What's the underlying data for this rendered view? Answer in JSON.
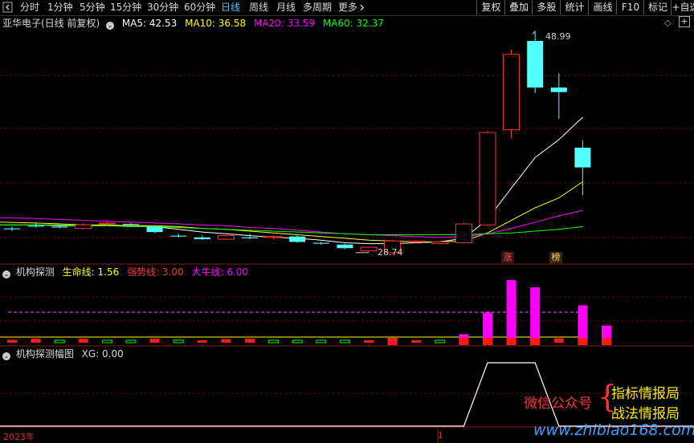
{
  "toolbar": {
    "nav_left_icon": "chevron-left-icon",
    "periods": [
      "分时",
      "1分钟",
      "5分钟",
      "15分钟",
      "30分钟",
      "60分钟",
      "日线",
      "周线",
      "月线",
      "多周期",
      "更多"
    ],
    "active_period": "日线",
    "more_icon": "chevron-right-icon",
    "buttons": [
      "复权",
      "叠加",
      "多股",
      "统计",
      "画线",
      "F10",
      "标记",
      "+自选"
    ]
  },
  "main_chart": {
    "title": "亚华电子(日线 前复权)",
    "ma": [
      {
        "label": "MA5: 42.53",
        "color": "#ffffff"
      },
      {
        "label": "MA10: 36.58",
        "color": "#ffff00"
      },
      {
        "label": "MA20: 33.59",
        "color": "#ff00ff"
      },
      {
        "label": "MA60: 32.37",
        "color": "#00ff00"
      }
    ],
    "high_label": "48.99",
    "low_label": "28.74",
    "badges": [
      "涨",
      "榜"
    ],
    "up_color": "#ff3232",
    "down_color": "#54ffff"
  },
  "indicator1": {
    "title": "机构探测",
    "lines": [
      {
        "label": "生命线: 1.56",
        "color": "#ffff00"
      },
      {
        "label": "强势线: 3.00",
        "color": "#ff3232"
      },
      {
        "label": "大牛线: 6.00",
        "color": "#ff00ff"
      }
    ]
  },
  "indicator2": {
    "title": "机构探测幅图",
    "xg_label": "XG: 0.00"
  },
  "footer": {
    "year_label": "2023年",
    "marker_label": "1"
  },
  "watermark": {
    "wechat_label": "微信公众号",
    "brace": "{",
    "line1": "指标情报局",
    "line2": "战法情报局",
    "url": "www.zhibiao168.com"
  },
  "chart_data": {
    "type": "candlestick",
    "series": [
      {
        "type": "candlestick",
        "ohlc": [
          [
            30.6,
            30.8,
            30.3,
            30.5
          ],
          [
            30.9,
            31.2,
            30.7,
            30.8
          ],
          [
            30.8,
            30.9,
            30.6,
            30.7
          ],
          [
            30.6,
            31.2,
            30.5,
            31.0
          ],
          [
            31.1,
            31.4,
            30.9,
            31.2
          ],
          [
            31.1,
            31.2,
            30.9,
            31.0
          ],
          [
            30.8,
            30.9,
            30.1,
            30.2
          ],
          [
            29.8,
            30.0,
            29.6,
            29.7
          ],
          [
            29.6,
            29.8,
            29.3,
            29.4
          ],
          [
            29.4,
            29.9,
            29.3,
            29.8
          ],
          [
            29.6,
            30.0,
            29.4,
            29.5
          ],
          [
            29.6,
            29.8,
            29.4,
            29.7
          ],
          [
            29.7,
            29.8,
            29.0,
            29.1
          ],
          [
            29.0,
            29.1,
            28.8,
            28.9
          ],
          [
            28.8,
            28.9,
            28.3,
            28.4
          ],
          [
            28.1,
            28.6,
            27.9,
            28.5
          ],
          [
            27.9,
            29.3,
            27.7,
            29.2
          ],
          [
            29.1,
            29.3,
            28.9,
            29.2
          ],
          [
            28.9,
            29.2,
            28.8,
            29.1
          ],
          [
            29.0,
            31.3,
            28.9,
            31.1
          ],
          [
            31.0,
            41.5,
            30.9,
            41.3
          ],
          [
            41.6,
            50.5,
            40.6,
            50.0
          ],
          [
            51.5,
            52.6,
            45.7,
            46.3
          ],
          [
            46.3,
            47.9,
            42.8,
            45.8
          ],
          [
            39.6,
            40.4,
            34.3,
            37.4
          ]
        ]
      },
      {
        "name": "MA5",
        "type": "line",
        "values": [
          31.0,
          31.0,
          30.9,
          30.9,
          30.9,
          30.9,
          30.8,
          30.5,
          30.2,
          30.0,
          29.8,
          29.6,
          29.5,
          29.3,
          29.0,
          28.9,
          28.9,
          29.0,
          29.1,
          29.5,
          31.6,
          35.1,
          38.5,
          40.5,
          43.0
        ]
      },
      {
        "name": "MA10",
        "type": "line",
        "values": [
          31.3,
          31.2,
          31.1,
          31.0,
          31.0,
          30.9,
          30.9,
          30.8,
          30.6,
          30.5,
          30.3,
          30.1,
          29.9,
          29.7,
          29.5,
          29.3,
          29.2,
          29.1,
          29.1,
          29.2,
          30.1,
          31.5,
          32.9,
          34.0,
          35.8
        ]
      },
      {
        "name": "MA20",
        "type": "line",
        "values": [
          31.8,
          31.7,
          31.6,
          31.5,
          31.4,
          31.3,
          31.2,
          31.1,
          31.0,
          30.9,
          30.7,
          30.6,
          30.4,
          30.2,
          30.0,
          29.9,
          29.8,
          29.7,
          29.6,
          29.7,
          30.0,
          30.6,
          31.3,
          32.0,
          32.6
        ]
      },
      {
        "name": "MA60",
        "type": "line",
        "values": [
          31.0,
          31.0,
          31.0,
          30.9,
          30.9,
          30.8,
          30.8,
          30.7,
          30.6,
          30.5,
          30.4,
          30.3,
          30.2,
          30.1,
          30.0,
          29.9,
          29.9,
          29.9,
          29.9,
          29.9,
          30.0,
          30.1,
          30.3,
          30.5,
          30.8
        ]
      }
    ],
    "indicator1": {
      "bars": [
        {
          "value": 0.4,
          "color": "#ff3232"
        },
        {
          "value": 0.55,
          "color": "#ff3232"
        },
        {
          "value": 0.3,
          "color": "#00ff00"
        },
        {
          "value": 0.55,
          "color": "#ff3232"
        },
        {
          "value": 0.25,
          "color": "#00ff00"
        },
        {
          "value": 0.15,
          "color": "#00ff00"
        },
        {
          "value": 0.55,
          "color": "#ff3232"
        },
        {
          "value": 0.35,
          "color": "#00ff00"
        },
        {
          "value": 0.25,
          "color": "#ff3232"
        },
        {
          "value": 0.5,
          "color": "#ff3232"
        },
        {
          "value": 0.55,
          "color": "#ff3232"
        },
        {
          "value": 0.15,
          "color": "#00ff00"
        },
        {
          "value": 0.3,
          "color": "#00ff00"
        },
        {
          "value": 0.15,
          "color": "#00ff00"
        },
        {
          "value": 0.2,
          "color": "#00ff00"
        },
        {
          "value": 0.3,
          "color": "#ff3232"
        },
        {
          "value": 1.0,
          "color": "#ff00ff"
        },
        {
          "value": 0.2,
          "color": "#ff3232"
        },
        {
          "value": 0.25,
          "color": "#00ff00"
        },
        {
          "value": 1.5,
          "color": "#ff00ff"
        },
        {
          "value": 4.5,
          "color": "#ff00ff"
        },
        {
          "value": 9.0,
          "color": "#ff00ff"
        },
        {
          "value": 8.0,
          "color": "#ff00ff"
        },
        {
          "value": 0.6,
          "color": "#ff3232"
        },
        {
          "value": 5.5,
          "color": "#ff00ff"
        },
        {
          "value": 2.7,
          "color": "#ff00ff"
        }
      ],
      "life_line": 1.56,
      "strong_line": 3.0
    },
    "indicator2": {
      "xg": [
        0,
        0,
        0,
        0,
        0,
        0,
        0,
        0,
        0,
        0,
        0,
        0,
        0,
        0,
        0,
        0,
        0,
        0,
        0,
        0,
        1,
        1,
        1,
        0,
        0
      ]
    }
  }
}
